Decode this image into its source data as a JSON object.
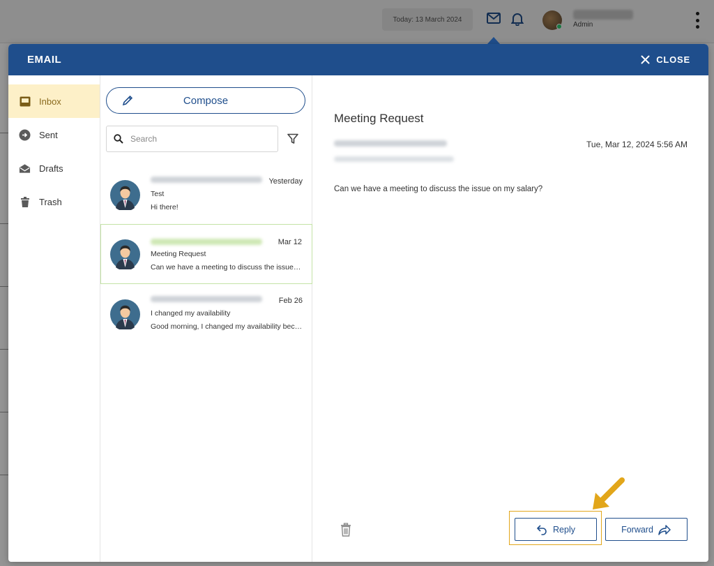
{
  "topbar": {
    "today_label": "Today: 13 March 2024",
    "user_role": "Admin",
    "mail_icon": "envelope-icon",
    "bell_icon": "bell-icon",
    "menu_icon": "kebab-icon"
  },
  "modal": {
    "title": "EMAIL",
    "close_label": "CLOSE"
  },
  "folders": [
    {
      "label": "Inbox",
      "icon": "inbox-icon",
      "active": true
    },
    {
      "label": "Sent",
      "icon": "sent-icon",
      "active": false
    },
    {
      "label": "Drafts",
      "icon": "drafts-icon",
      "active": false
    },
    {
      "label": "Trash",
      "icon": "trash-icon",
      "active": false
    }
  ],
  "list": {
    "compose_label": "Compose",
    "search_placeholder": "Search",
    "messages": [
      {
        "date": "Yesterday",
        "subject": "Test",
        "preview": "Hi there!",
        "selected": false
      },
      {
        "date": "Mar 12",
        "subject": "Meeting Request",
        "preview": "Can we have a meeting to discuss the issue on my salary?",
        "selected": true
      },
      {
        "date": "Feb 26",
        "subject": "I changed my availability",
        "preview": "Good morning, I changed my availability because of my new schedule",
        "selected": false
      }
    ]
  },
  "reader": {
    "subject": "Meeting Request",
    "date": "Tue, Mar 12, 2024 5:56 AM",
    "body": "Can we have a meeting to discuss the issue on my salary?",
    "reply_label": "Reply",
    "forward_label": "Forward"
  },
  "colors": {
    "header_blue": "#1f4e8c",
    "active_folder_bg": "#fdf0c8",
    "highlight_orange": "#e2a61a",
    "selected_border": "#c4e3a6"
  }
}
